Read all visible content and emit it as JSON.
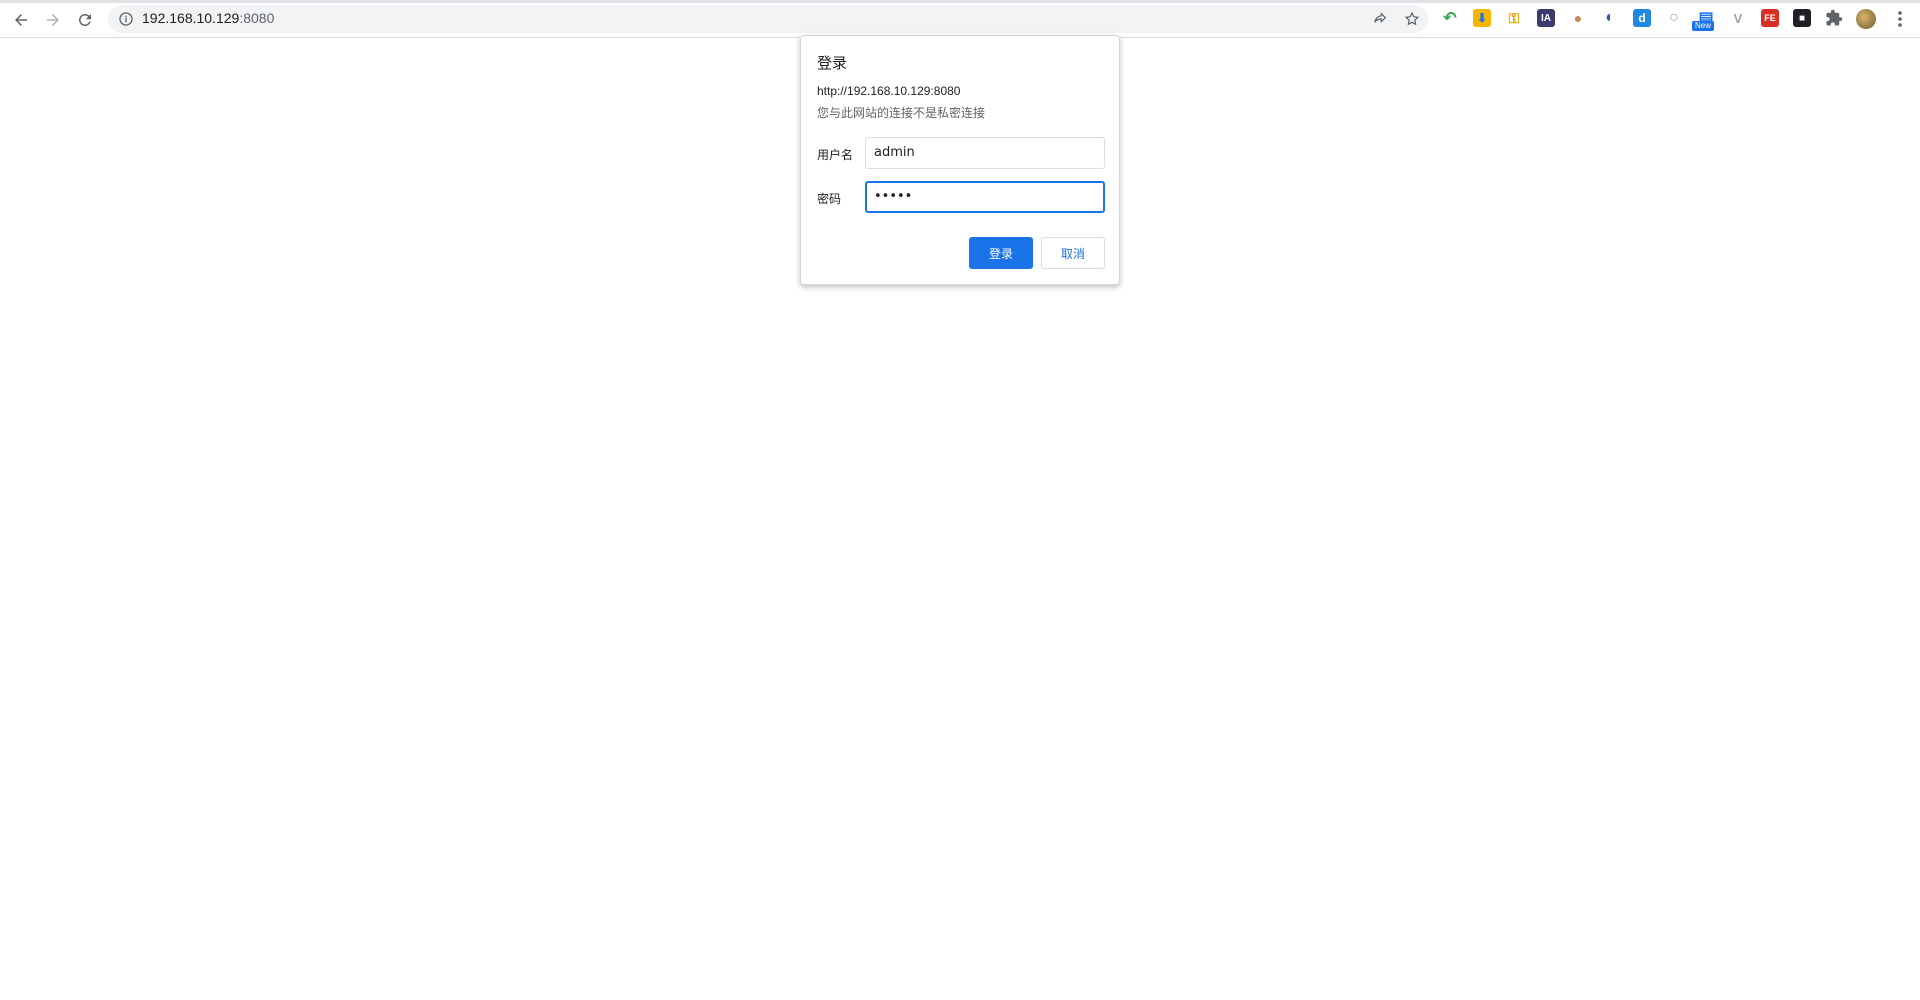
{
  "browser": {
    "url_host": "192.168.10.129",
    "url_port": ":8080",
    "extensions": [
      {
        "name": "undo-arrow-extension",
        "color": "#34a853",
        "glyph": "↶"
      },
      {
        "name": "download-extension",
        "color": "#1a73e8",
        "glyph": "⬇"
      },
      {
        "name": "key-extension",
        "color": "#f4b400",
        "glyph": "⚿"
      },
      {
        "name": "ia-extension",
        "color": "#3c3b6e",
        "glyph": "IA"
      },
      {
        "name": "cookie-extension",
        "color": "#c58b5a",
        "glyph": "●"
      },
      {
        "name": "swirl-extension",
        "color": "#3f51b5",
        "glyph": "◐"
      },
      {
        "name": "d-extension",
        "color": "#1e88e5",
        "glyph": "d"
      },
      {
        "name": "circle-extension",
        "color": "#ffffff",
        "glyph": "○"
      },
      {
        "name": "new-extension",
        "color": "#1a73e8",
        "glyph": "▤"
      },
      {
        "name": "v-extension",
        "color": "#9aa0a6",
        "glyph": "V"
      },
      {
        "name": "fe-extension",
        "color": "#d93025",
        "glyph": "FE"
      },
      {
        "name": "mask-extension",
        "color": "#202124",
        "glyph": "■"
      }
    ],
    "new_badge": "New"
  },
  "dialog": {
    "title": "登录",
    "origin": "http://192.168.10.129:8080",
    "warning": "您与此网站的连接不是私密连接",
    "username_label": "用户名",
    "username_value": "admin",
    "password_label": "密码",
    "password_value": "•••••",
    "login_button": "登录",
    "cancel_button": "取消"
  }
}
